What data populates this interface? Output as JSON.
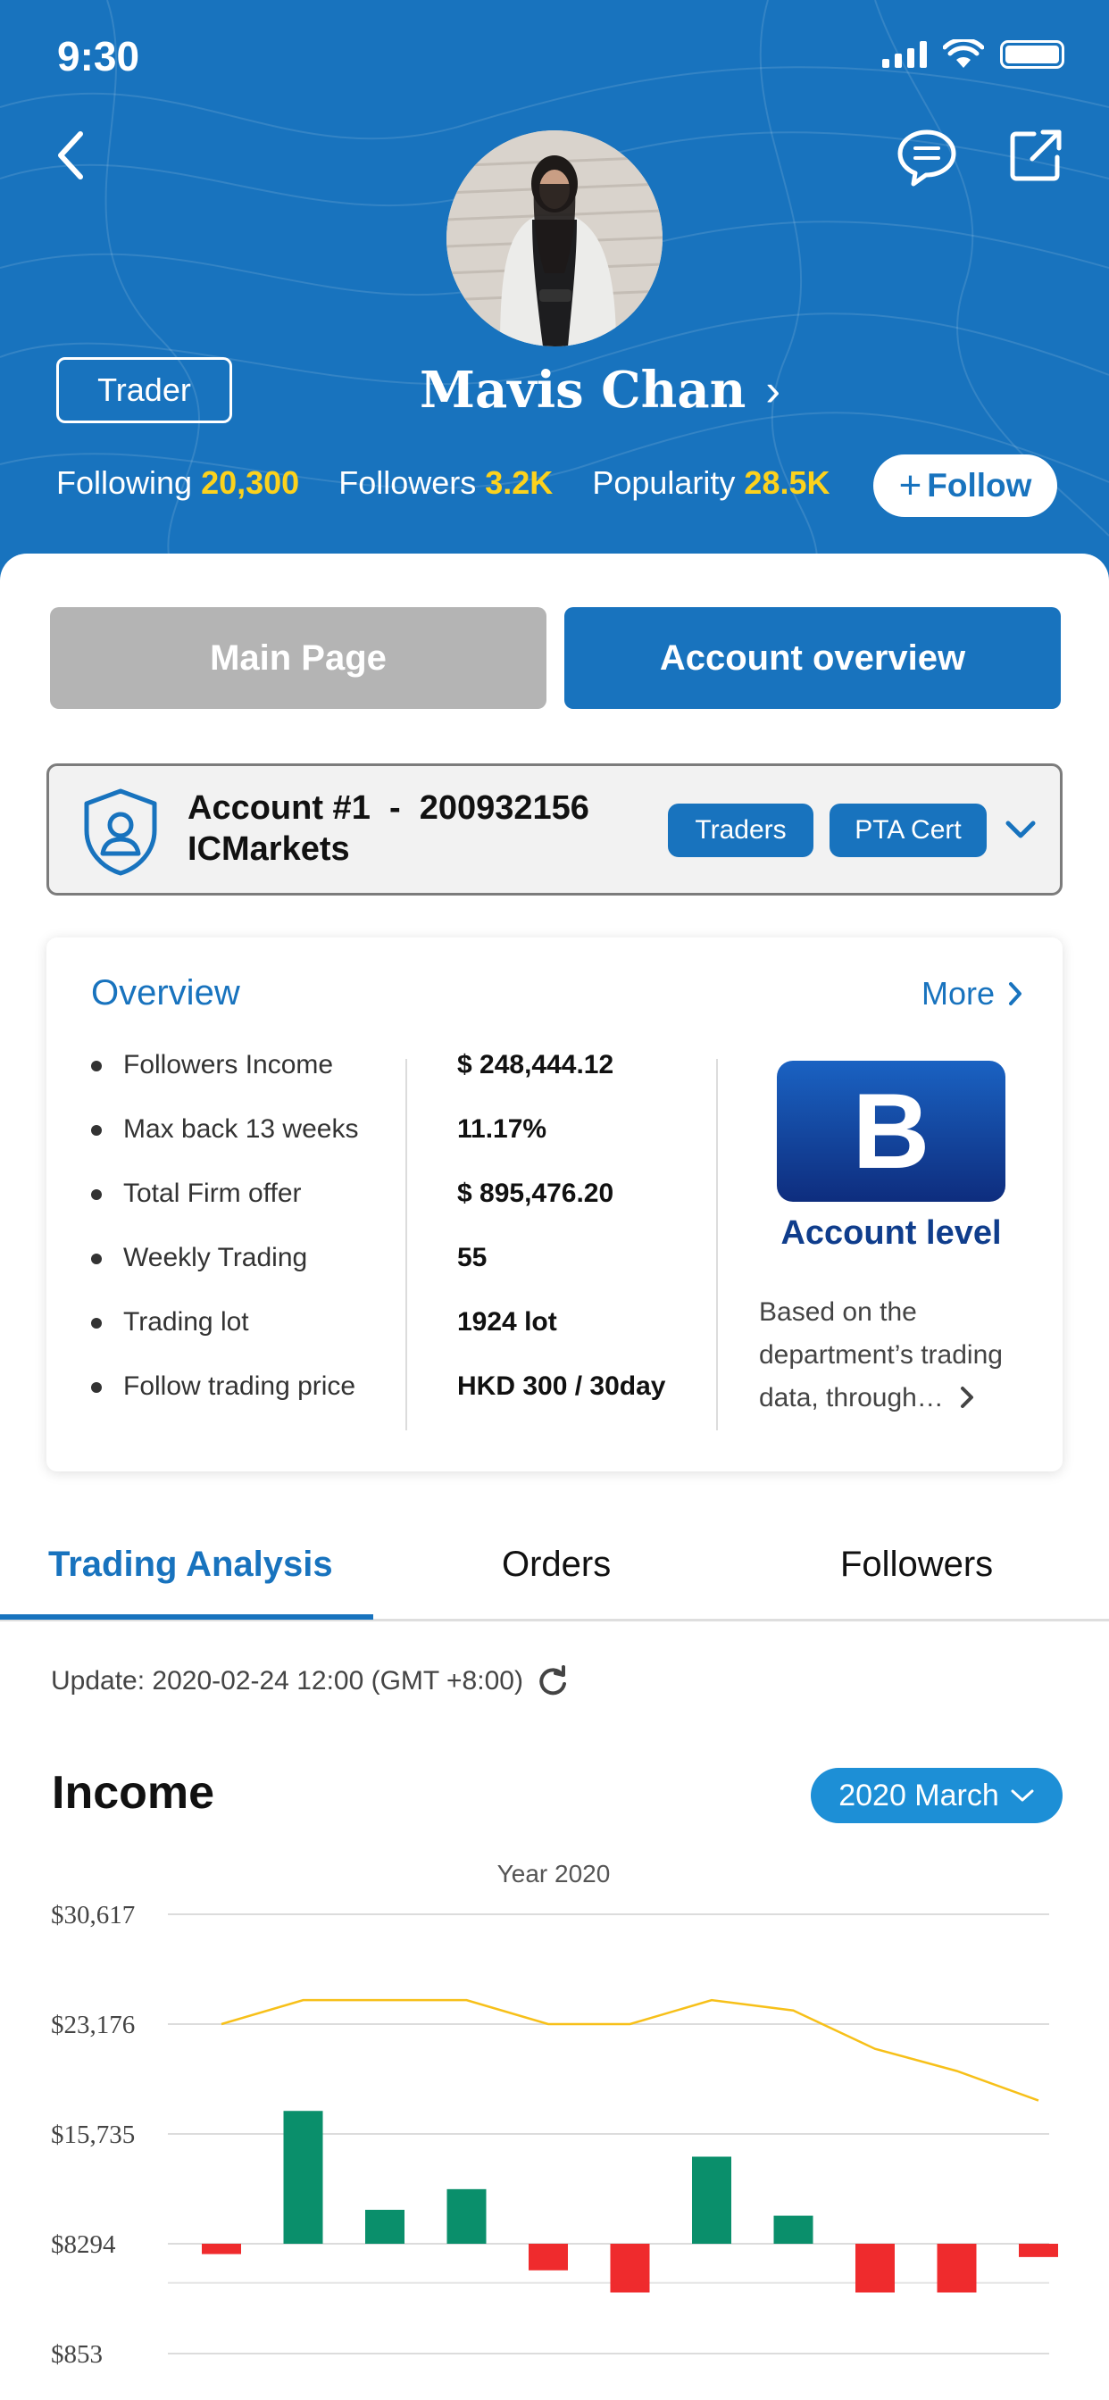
{
  "status_bar": {
    "time": "9:30"
  },
  "profile": {
    "role_tag": "Trader",
    "name": "Mavis Chan",
    "stats": [
      {
        "label": "Following",
        "value": "20,300"
      },
      {
        "label": "Followers",
        "value": "3.2K"
      },
      {
        "label": "Popularity",
        "value": "28.5K"
      }
    ],
    "follow_label": "Follow"
  },
  "segments": {
    "main": "Main Page",
    "account": "Account overview"
  },
  "account": {
    "line1": "Account #1  -  200932156",
    "broker": "ICMarkets",
    "tags": [
      "Traders",
      "PTA Cert"
    ]
  },
  "overview": {
    "title": "Overview",
    "more": "More",
    "rows": [
      {
        "label": "Followers Income",
        "value": "$ 248,444.12"
      },
      {
        "label": "Max back 13 weeks",
        "value": "11.17%"
      },
      {
        "label": "Total Firm offer",
        "value": "$ 895,476.20"
      },
      {
        "label": "Weekly Trading",
        "value": "55"
      },
      {
        "label": "Trading lot",
        "value": "1924 lot"
      },
      {
        "label": "Follow trading price",
        "value": "HKD 300 / 30day"
      }
    ],
    "level_letter": "B",
    "level_label": "Account level",
    "level_desc": "Based on the department’s trading data, through…"
  },
  "tabs": [
    "Trading Analysis",
    "Orders",
    "Followers"
  ],
  "update_text": "Update: 2020-02-24 12:00 (GMT +8:00)",
  "income": {
    "title": "Income",
    "period": "2020 March"
  },
  "chart_data": {
    "type": "bar",
    "title": "Year 2020",
    "y_ticks": [
      "$30,617",
      "$23,176",
      "$15,735",
      "$8294",
      "$853"
    ],
    "ylim": [
      853,
      30617
    ],
    "baseline": 8294,
    "values": [
      -700,
      9000,
      2300,
      3700,
      -1800,
      -3300,
      5900,
      1900,
      -3300,
      -3300,
      -900
    ],
    "line": [
      23176,
      24800,
      24800,
      24800,
      23176,
      23176,
      24800,
      24100,
      21500,
      20000,
      18000
    ],
    "colors": {
      "positive": "#0a8f6b",
      "negative": "#ef2b2d",
      "line": "#f7c019"
    }
  },
  "colors": {
    "primary": "#1873be",
    "accent": "#fcd21d",
    "inactive": "#b4b4b4"
  }
}
